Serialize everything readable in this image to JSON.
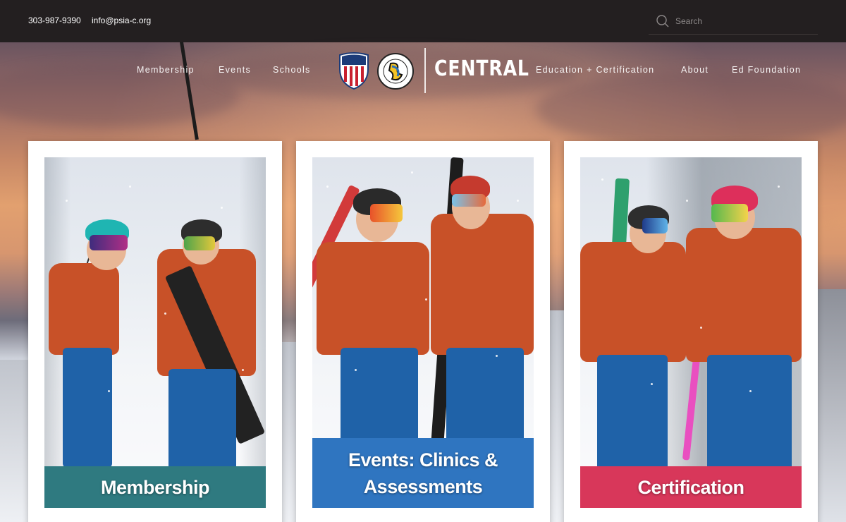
{
  "topbar": {
    "phone": "303-987-9390",
    "email": "info@psia-c.org",
    "search_placeholder": "Search"
  },
  "nav": {
    "left": [
      "Membership",
      "Events",
      "Schools"
    ],
    "right": [
      "Education + Certification",
      "About",
      "Ed Foundation"
    ],
    "brand": "CENTRAL"
  },
  "cards": [
    {
      "label": "Membership",
      "color": "#2f7a80"
    },
    {
      "label": "Events: Clinics & Assessments",
      "color": "#2f75c0"
    },
    {
      "label": "Certification",
      "color": "#d8375a"
    }
  ],
  "icons": {
    "search": "search-icon",
    "psia_logo": "psia-shield-logo",
    "aasi_logo": "aasi-circle-logo"
  }
}
